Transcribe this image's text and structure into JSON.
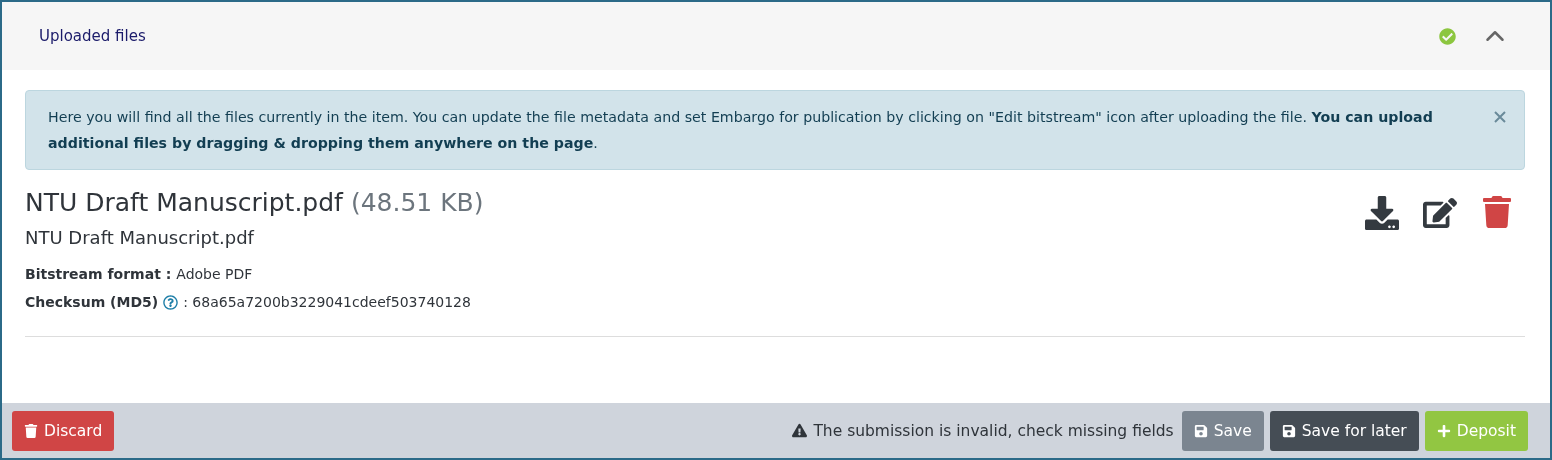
{
  "section": {
    "title": "Uploaded files",
    "valid": true,
    "expanded": true
  },
  "alert": {
    "text": "Here you will find all the files currently in the item. You can update the file metadata and set Embargo for publication by clicking on \"Edit bitstream\" icon after uploading the file. **You can upload additional files by dragging & dropping them anywhere on the page**."
  },
  "file": {
    "name": "NTU Draft Manuscript.pdf",
    "size": "(48.51 KB)",
    "title": "NTU Draft Manuscript.pdf",
    "fields": [
      {
        "label": "Bitstream format :",
        "value": "Adobe PDF",
        "help": false
      },
      {
        "label": "Checksum (MD5)",
        "value": ": 68a65a7200b3229041cdeef503740128",
        "help": true
      }
    ]
  },
  "footer": {
    "discard": "Discard",
    "warning": "The submission is invalid, check missing fields",
    "buttons": [
      {
        "label": "Save",
        "kind": "secondary"
      },
      {
        "label": "Save for later",
        "kind": "dark"
      },
      {
        "label": "Deposit",
        "kind": "success"
      }
    ]
  }
}
